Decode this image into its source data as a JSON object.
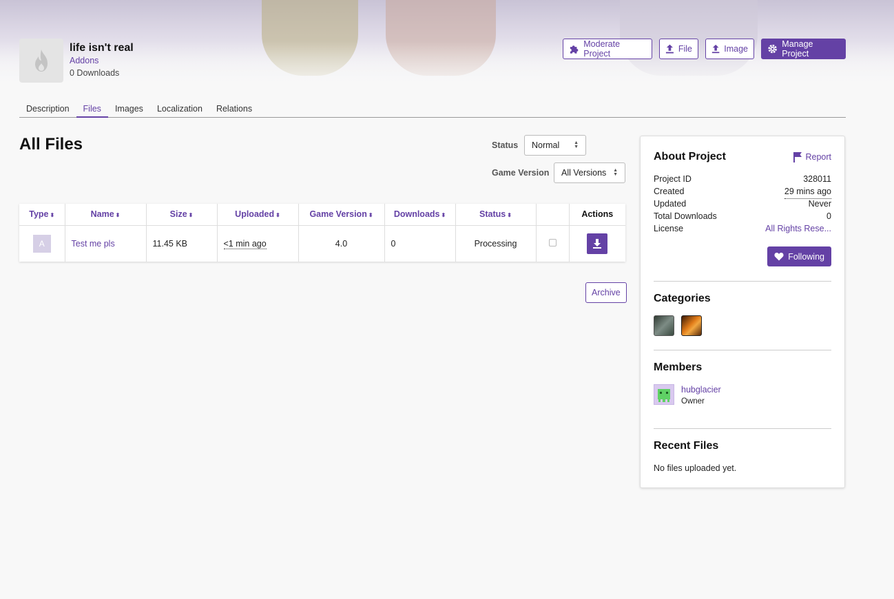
{
  "project": {
    "title": "life isn't real",
    "category": "Addons",
    "downloads": "0 Downloads",
    "avatar_icon": "flame-icon"
  },
  "header_actions": {
    "moderate": "Moderate Project",
    "file": "File",
    "image": "Image",
    "manage": "Manage Project"
  },
  "tabs": [
    "Description",
    "Files",
    "Images",
    "Localization",
    "Relations"
  ],
  "active_tab": "Files",
  "main": {
    "heading": "All Files",
    "status_label": "Status",
    "status_value": "Normal",
    "game_version_label": "Game Version",
    "game_version_value": "All Versions",
    "archive_label": "Archive"
  },
  "table": {
    "columns": [
      "Type",
      "Name",
      "Size",
      "Uploaded",
      "Game Version",
      "Downloads",
      "Status",
      "",
      "Actions"
    ],
    "rows": [
      {
        "type": "A",
        "name": "Test me pls",
        "size": "11.45 KB",
        "uploaded": "<1 min ago",
        "game_version": "4.0",
        "downloads": "0",
        "status": "Processing",
        "checked": false,
        "action_icon": "download-icon"
      }
    ]
  },
  "sidebar": {
    "about_title": "About Project",
    "report_label": "Report",
    "details": [
      {
        "label": "Project ID",
        "value": "328011"
      },
      {
        "label": "Created",
        "value": "29 mins ago"
      },
      {
        "label": "Updated",
        "value": "Never"
      },
      {
        "label": "Total Downloads",
        "value": "0"
      },
      {
        "label": "License",
        "value": "All Rights Rese..."
      }
    ],
    "follow_label": "Following",
    "categories_title": "Categories",
    "categories": [
      "category-icon-1",
      "category-icon-2"
    ],
    "members_title": "Members",
    "members": [
      {
        "name": "hubglacier",
        "role": "Owner"
      }
    ],
    "recent_title": "Recent Files",
    "recent_empty": "No files uploaded yet."
  },
  "colors": {
    "accent": "#6441a5",
    "background": "#f8f8f8"
  }
}
